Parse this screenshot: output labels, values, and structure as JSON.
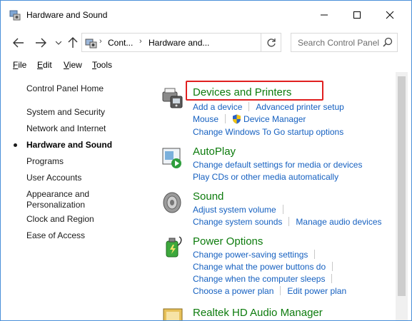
{
  "window": {
    "title": "Hardware and Sound"
  },
  "address": {
    "crumbs": [
      "Cont...",
      "Hardware and..."
    ]
  },
  "search": {
    "placeholder": "Search Control Panel"
  },
  "menu": {
    "file": {
      "key": "F",
      "rest": "ile"
    },
    "edit": {
      "key": "E",
      "rest": "dit"
    },
    "view": {
      "key": "V",
      "rest": "iew"
    },
    "tools": {
      "key": "T",
      "rest": "ools"
    }
  },
  "sidebar": {
    "items": [
      {
        "label": "Control Panel Home"
      },
      {
        "label": "System and Security"
      },
      {
        "label": "Network and Internet"
      },
      {
        "label": "Hardware and Sound",
        "current": true
      },
      {
        "label": "Programs"
      },
      {
        "label": "User Accounts"
      },
      {
        "label": "Appearance and"
      },
      {
        "label": "Personalization"
      },
      {
        "label": "Clock and Region"
      },
      {
        "label": "Ease of Access"
      }
    ]
  },
  "categories": [
    {
      "title": "Devices and Printers",
      "icon": "printer-icon",
      "rows": [
        [
          "Add a device",
          "Advanced printer setup"
        ],
        [
          "Mouse",
          "Device Manager"
        ],
        [
          "Change Windows To Go startup options"
        ]
      ]
    },
    {
      "title": "AutoPlay",
      "icon": "autoplay-icon",
      "rows": [
        [
          "Change default settings for media or devices"
        ],
        [
          "Play CDs or other media automatically"
        ]
      ]
    },
    {
      "title": "Sound",
      "icon": "speaker-icon",
      "rows": [
        [
          "Adjust system volume"
        ],
        [
          "Change system sounds",
          "Manage audio devices"
        ]
      ]
    },
    {
      "title": "Power Options",
      "icon": "battery-icon",
      "rows": [
        [
          "Change power-saving settings"
        ],
        [
          "Change what the power buttons do"
        ],
        [
          "Change when the computer sleeps"
        ],
        [
          "Choose a power plan",
          "Edit power plan"
        ]
      ]
    },
    {
      "title": "Realtek HD Audio Manager",
      "icon": "realtek-icon",
      "rows": []
    }
  ],
  "colors": {
    "category_title": "#0c7b0c",
    "link": "#1560c0",
    "highlight_box": "#e02020"
  }
}
